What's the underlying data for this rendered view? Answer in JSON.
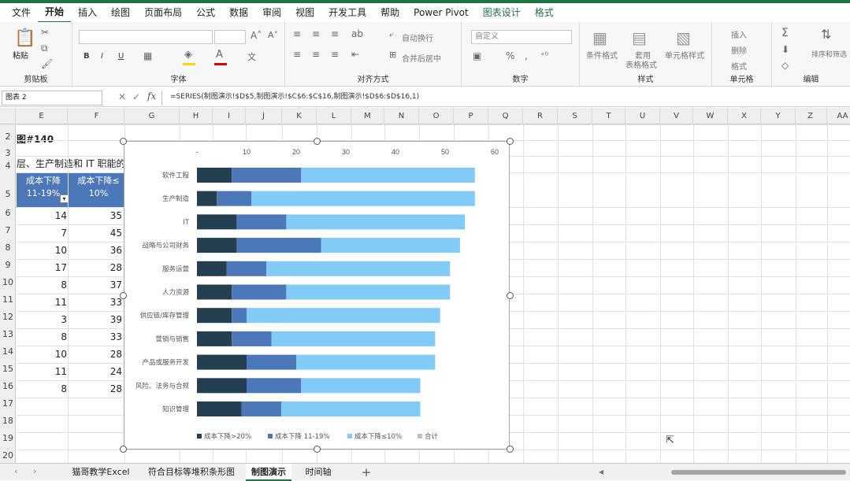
{
  "menu": [
    "文件",
    "开始",
    "插入",
    "绘图",
    "页面布局",
    "公式",
    "数据",
    "审阅",
    "视图",
    "开发工具",
    "帮助",
    "Power Pivot",
    "图表设计",
    "格式"
  ],
  "ribbon": {
    "paste": "粘贴",
    "clipboard": "剪贴板",
    "font": "字体",
    "align": "对齐方式",
    "wrap": "自动换行",
    "merge": "合并后居中",
    "number_format": "自定义",
    "number": "数字",
    "cond_fmt": "条件格式",
    "table_fmt1": "套用",
    "table_fmt2": "表格格式",
    "cell_style": "单元格样式",
    "styles": "样式",
    "insert": "插入",
    "delete": "删除",
    "format": "格式",
    "cells": "单元格",
    "sort": "排序和筛选",
    "editing": "编辑",
    "bold": "B",
    "italic": "I",
    "underline": "U"
  },
  "formula": {
    "name_box": "图表 2",
    "content": "=SERIES(制图演示!$D$5,制图演示!$C$6:$C$16,制图演示!$D$6:$D$16,1)"
  },
  "columns": [
    "E",
    "F",
    "G",
    "H",
    "I",
    "J",
    "K",
    "L",
    "M",
    "N",
    "O",
    "P",
    "Q",
    "R",
    "S",
    "T",
    "U",
    "V",
    "W",
    "X",
    "Y",
    "Z",
    "AA"
  ],
  "rows": [
    "2",
    "3",
    "4",
    "5",
    "6",
    "7",
    "8",
    "9",
    "10",
    "11",
    "12",
    "13",
    "14",
    "15",
    "16",
    "17",
    "18",
    "19",
    "20"
  ],
  "sheet": {
    "title": "图#140",
    "subtitle": "层、生产制造和 IT 职能的成",
    "header_e": "成本下降\n11-19%",
    "header_f": "成本下降≤\n10%",
    "col_e": [
      "14",
      "7",
      "10",
      "17",
      "8",
      "11",
      "3",
      "8",
      "10",
      "11",
      "8"
    ],
    "col_f": [
      "35",
      "45",
      "36",
      "28",
      "37",
      "33",
      "39",
      "33",
      "28",
      "24",
      "28"
    ]
  },
  "chart_data": {
    "type": "bar",
    "stacked": true,
    "orientation": "horizontal",
    "categories": [
      "软件工程",
      "生产制造",
      "IT",
      "战略与公司财务",
      "服务运营",
      "人力资源",
      "供应链/库存管理",
      "营销与销售",
      "产品或服务开发",
      "风险、法务与合规",
      "知识管理"
    ],
    "series": [
      {
        "name": "成本下降>20%",
        "color": "#243f4f",
        "values": [
          7,
          4,
          8,
          8,
          6,
          7,
          7,
          7,
          10,
          10,
          9
        ]
      },
      {
        "name": "成本下降 11-19%",
        "color": "#4c78b9",
        "values": [
          14,
          7,
          10,
          17,
          8,
          11,
          3,
          8,
          10,
          11,
          8
        ]
      },
      {
        "name": "成本下降≤10%",
        "color": "#82cbf7",
        "values": [
          35,
          45,
          36,
          28,
          37,
          33,
          39,
          33,
          28,
          24,
          28
        ]
      },
      {
        "name": "合计",
        "color": "#bfbfbf",
        "values": []
      }
    ],
    "xlim": [
      0,
      60
    ],
    "x_ticks": [
      "-",
      "10",
      "20",
      "30",
      "40",
      "50",
      "60"
    ],
    "legend": "bottom"
  },
  "tabs": [
    "猫哥教学Excel",
    "符合目标等堆积条形图",
    "制图演示",
    "时间轴"
  ],
  "add_sheet": "+"
}
